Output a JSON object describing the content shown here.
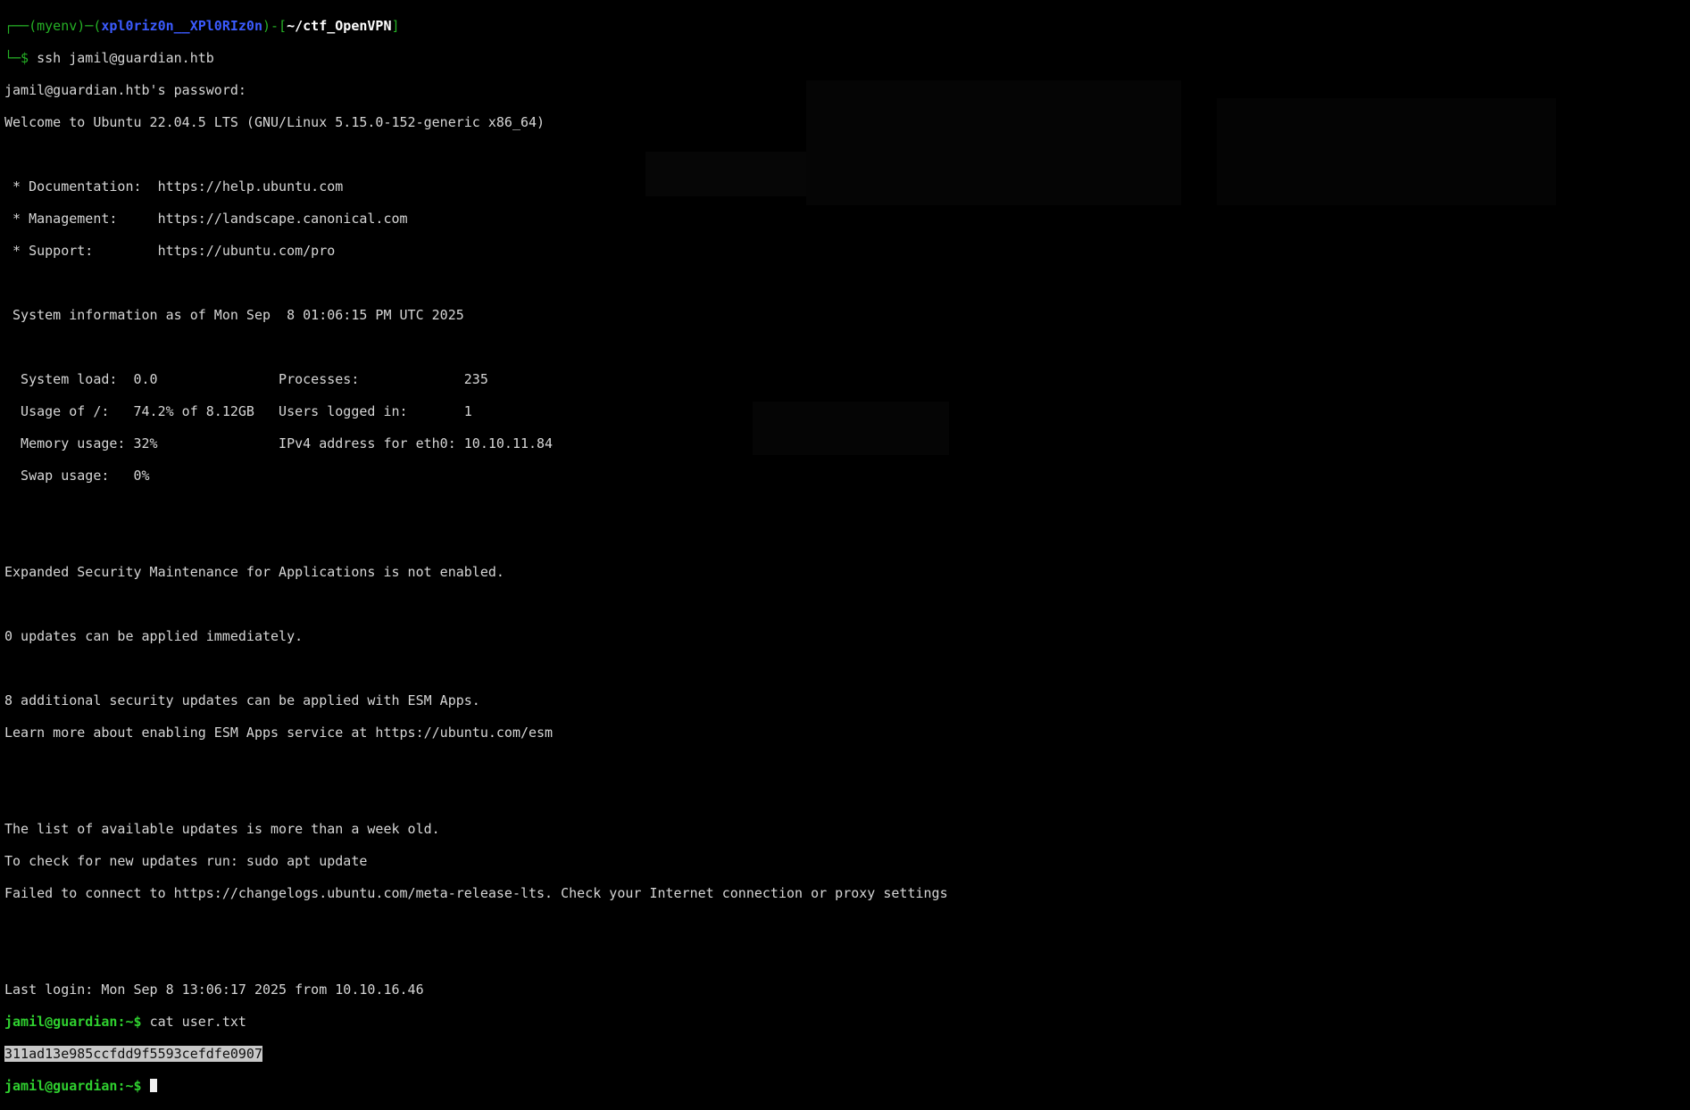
{
  "prompt": {
    "env": "myenv",
    "host": "xpl0riz0n__XPl0RIz0n",
    "path": "~/ctf_OpenVPN",
    "command": "ssh jamil@guardian.htb"
  },
  "password_prompt": "jamil@guardian.htb's password:",
  "welcome": "Welcome to Ubuntu 22.04.5 LTS (GNU/Linux 5.15.0-152-generic x86_64)",
  "links": [
    {
      "label": " * Documentation:  ",
      "url": "https://help.ubuntu.com"
    },
    {
      "label": " * Management:     ",
      "url": "https://landscape.canonical.com"
    },
    {
      "label": " * Support:        ",
      "url": "https://ubuntu.com/pro"
    }
  ],
  "sysinfo_header": " System information as of Mon Sep  8 01:06:15 PM UTC 2025",
  "sysinfo": [
    "  System load:  0.0               Processes:             235",
    "  Usage of /:   74.2% of 8.12GB   Users logged in:       1",
    "  Memory usage: 32%               IPv4 address for eth0: 10.10.11.84",
    "  Swap usage:   0%"
  ],
  "esm_notice": "Expanded Security Maintenance for Applications is not enabled.",
  "updates_now": "0 updates can be applied immediately.",
  "esm_updates": "8 additional security updates can be applied with ESM Apps.",
  "esm_learn": "Learn more about enabling ESM Apps service at https://ubuntu.com/esm",
  "list_old": "The list of available updates is more than a week old.",
  "check_updates": "To check for new updates run: sudo apt update",
  "failed_connect": "Failed to connect to https://changelogs.ubuntu.com/meta-release-lts. Check your Internet connection or proxy settings",
  "last_login": "Last login: Mon Sep 8 13:06:17 2025 from 10.10.16.46",
  "remote_prompt": {
    "user_host": "jamil@guardian",
    "suffix": ":~$ ",
    "command": "cat user.txt"
  },
  "flag": "311ad13e985ccfdd9f5593cefdfe0907",
  "final_prompt": {
    "user_host": "jamil@guardian",
    "suffix": ":~$ "
  }
}
